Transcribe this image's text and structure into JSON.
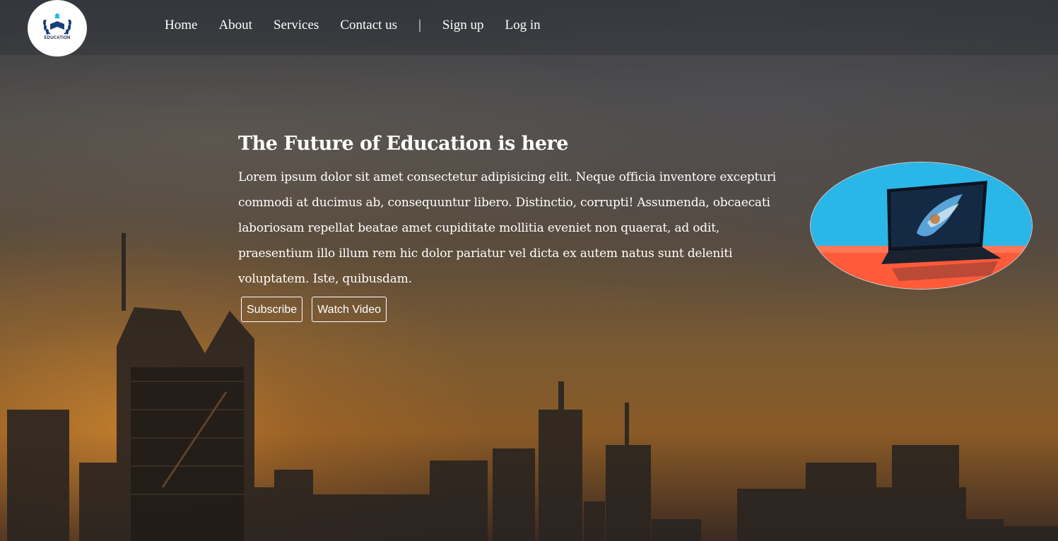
{
  "brand": {
    "logo_text": "EDUCATION"
  },
  "nav": {
    "items": [
      "Home",
      "About",
      "Services",
      "Contact us"
    ],
    "separator": "|",
    "signup": "Sign up",
    "login": "Log in"
  },
  "hero": {
    "title": "The Future of Education is here",
    "body": "Lorem ipsum dolor sit amet consectetur adipisicing elit. Neque officia inventore excepturi commodi at ducimus ab, consequuntur libero. Distinctio, corrupti! Assumenda, obcaecati laboriosam repellat beatae amet cupiditate mollitia eveniet non quaerat, ad odit, praesentium illo illum rem hic dolor pariatur vel dicta ex autem natus sunt deleniti voluptatem. Iste, quibusdam.",
    "subscribe_label": "Subscribe",
    "watch_label": "Watch Video"
  },
  "colors": {
    "text": "#ffffff",
    "logo_blue": "#1b3f7a",
    "image_bg": "#2bb6e8",
    "image_table": "#ff5a3a"
  }
}
